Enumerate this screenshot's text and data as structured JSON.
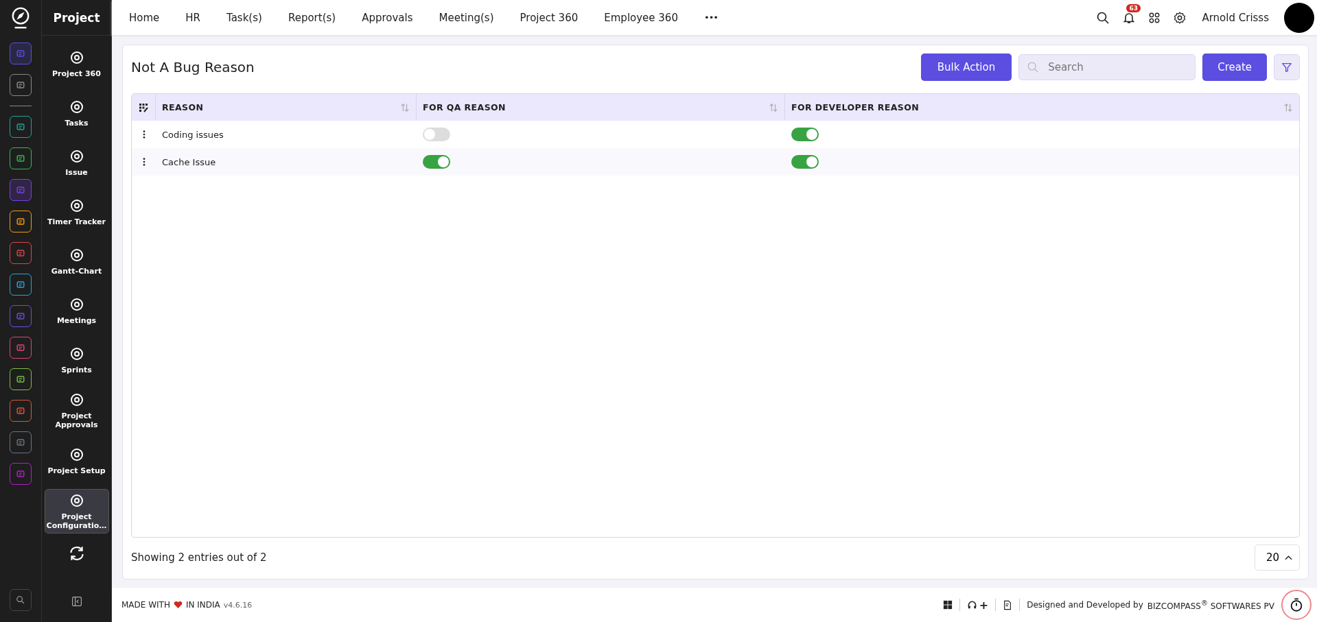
{
  "rail": {
    "items": [
      {
        "color": "#5b4ee0",
        "selected": true
      },
      {
        "color": "#8a8a8a",
        "selected": false
      },
      {
        "color": "#1fa39a",
        "selected": false
      },
      {
        "color": "#2fbf4f",
        "selected": false
      },
      {
        "color": "#7b3fe4",
        "selected": true
      },
      {
        "color": "#f29d12",
        "selected": false
      },
      {
        "color": "#e0434a",
        "selected": false
      },
      {
        "color": "#20a7d8",
        "selected": false
      },
      {
        "color": "#6e4be8",
        "selected": false
      },
      {
        "color": "#e0457b",
        "selected": false
      },
      {
        "color": "#7ac142",
        "selected": false
      },
      {
        "color": "#e0553b",
        "selected": false
      },
      {
        "color": "#6b7384",
        "selected": false
      },
      {
        "color": "#b21fc9",
        "selected": false
      }
    ]
  },
  "sidebar": {
    "title": "Project",
    "items": [
      {
        "label": "Project 360",
        "selected": false
      },
      {
        "label": "Tasks",
        "selected": false
      },
      {
        "label": "Issue",
        "selected": false
      },
      {
        "label": "Timer Tracker",
        "selected": false
      },
      {
        "label": "Gantt-Chart",
        "selected": false
      },
      {
        "label": "Meetings",
        "selected": false
      },
      {
        "label": "Sprints",
        "selected": false
      },
      {
        "label": "Project Approvals",
        "selected": false
      },
      {
        "label": "Project Setup",
        "selected": false
      },
      {
        "label": "Project Configuratio…",
        "selected": true
      }
    ]
  },
  "topnav": {
    "items": [
      "Home",
      "HR",
      "Task(s)",
      "Report(s)",
      "Approvals",
      "Meeting(s)",
      "Project 360",
      "Employee 360"
    ],
    "more": "•••",
    "notifications": "63",
    "user": "Arnold Crisss"
  },
  "page": {
    "title": "Not A Bug Reason",
    "bulk_action": "Bulk Action",
    "search": {
      "placeholder": "Search"
    },
    "create": "Create"
  },
  "table": {
    "columns": [
      "REASON",
      "FOR QA REASON",
      "FOR DEVELOPER REASON"
    ],
    "rows": [
      {
        "reason": "Coding issues",
        "qa_reason": false,
        "developer_reason": true
      },
      {
        "reason": "Cache Issue",
        "qa_reason": true,
        "developer_reason": true
      }
    ]
  },
  "pagination": {
    "summary": "Showing 2 entries out of 2",
    "page_size": "20"
  },
  "footer": {
    "made_with": "MADE WITH",
    "in_india": "IN INDIA",
    "version": "v4.6.16",
    "plus": "+",
    "credit": "Designed and Developed by",
    "company": "BIZCOMPASS$^{®}$ SOFTWARES PV"
  }
}
